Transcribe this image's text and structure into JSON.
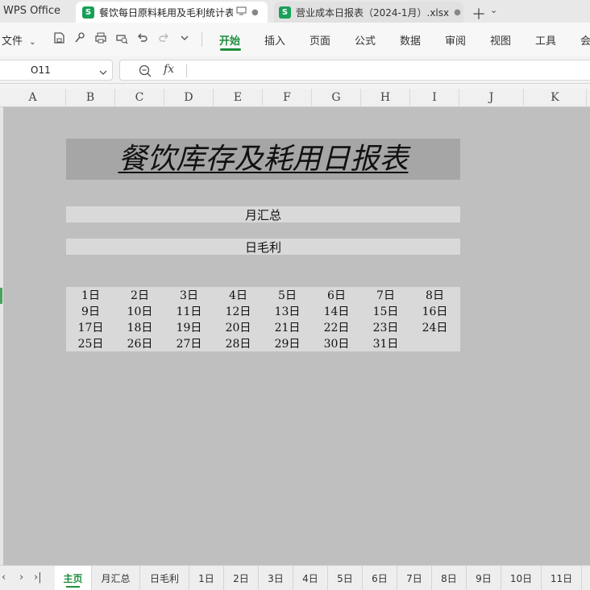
{
  "app": {
    "name": "WPS Office"
  },
  "window_tabs": [
    {
      "label": "餐饮每日原料耗用及毛利统计表",
      "badge": "S"
    },
    {
      "label": "营业成本日报表（2024-1月）.xlsx",
      "badge": "S"
    }
  ],
  "toolbar": {
    "file_label": "文件",
    "ribbon_tabs": [
      "开始",
      "插入",
      "页面",
      "公式",
      "数据",
      "审阅",
      "视图",
      "工具",
      "会"
    ]
  },
  "formula_bar": {
    "cell_ref": "O11",
    "fx_label": "fx",
    "value": ""
  },
  "columns": [
    "A",
    "B",
    "C",
    "D",
    "E",
    "F",
    "G",
    "H",
    "I",
    "J",
    "K"
  ],
  "sheet": {
    "title": "餐饮库存及耗用日报表",
    "buttons": {
      "monthly": "月汇总",
      "profit": "日毛利"
    },
    "days": [
      "1日",
      "2日",
      "3日",
      "4日",
      "5日",
      "6日",
      "7日",
      "8日",
      "9日",
      "10日",
      "11日",
      "12日",
      "13日",
      "14日",
      "15日",
      "16日",
      "17日",
      "18日",
      "19日",
      "20日",
      "21日",
      "22日",
      "23日",
      "24日",
      "25日",
      "26日",
      "27日",
      "28日",
      "29日",
      "30日",
      "31日"
    ]
  },
  "sheet_tabs": [
    "主页",
    "月汇总",
    "日毛利",
    "1日",
    "2日",
    "3日",
    "4日",
    "5日",
    "6日",
    "7日",
    "8日",
    "9日",
    "10日",
    "11日"
  ],
  "colors": {
    "accent": "#1f8e3e",
    "sheet_bg": "#bfbfbf",
    "title_bg": "#a6a6a6",
    "button_bg": "#d9d9d9"
  }
}
